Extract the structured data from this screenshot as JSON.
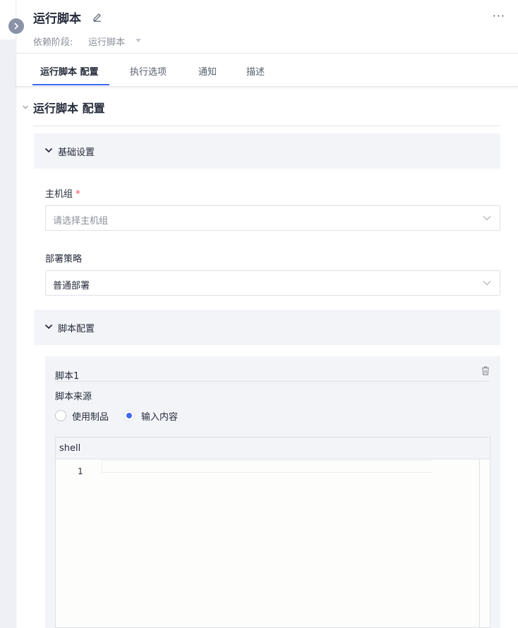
{
  "header": {
    "title": "运行脚本",
    "dependency_label": "依赖阶段:",
    "dependency_value": "运行脚本",
    "more": "···"
  },
  "tabs": [
    {
      "label": "运行脚本 配置"
    },
    {
      "label": "执行选项"
    },
    {
      "label": "通知"
    },
    {
      "label": "描述"
    }
  ],
  "section": {
    "title": "运行脚本 配置",
    "basic_group": "基础设置",
    "host_group_label": "主机组",
    "host_group_required": "*",
    "host_group_placeholder": "请选择主机组",
    "strategy_label": "部署策略",
    "strategy_value": "普通部署",
    "script_group": "脚本配置"
  },
  "script": {
    "name": "脚本1",
    "source_label": "脚本来源",
    "options": [
      "使用制品",
      "输入内容"
    ],
    "selected": "输入内容",
    "editor_language": "shell",
    "line_numbers": [
      "1"
    ]
  },
  "colors": {
    "accent": "#3e69f5",
    "required": "#f5455c",
    "group_bg": "#f3f4f8"
  }
}
